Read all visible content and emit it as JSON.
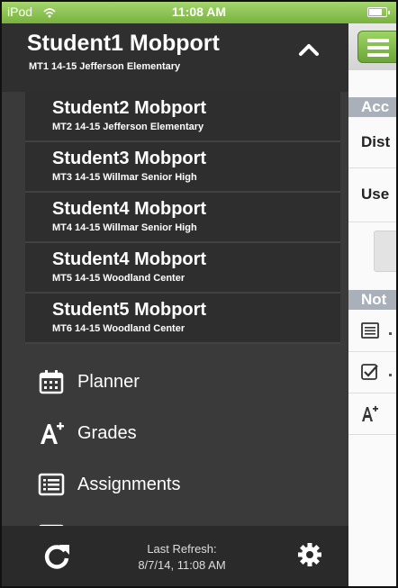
{
  "status_bar": {
    "carrier": "iPod",
    "time": "11:08 AM",
    "battery_level": 0.75
  },
  "current_student": {
    "name": "Student1 Mobport",
    "subtitle": "MT1 14-15 Jefferson Elementary"
  },
  "students": [
    {
      "name": "Student2 Mobport",
      "subtitle": "MT2 14-15 Jefferson Elementary"
    },
    {
      "name": "Student3 Mobport",
      "subtitle": "MT3 14-15 Willmar Senior High"
    },
    {
      "name": "Student4 Mobport",
      "subtitle": "MT4 14-15 Willmar Senior High"
    },
    {
      "name": "Student4 Mobport",
      "subtitle": "MT5 14-15 Woodland Center"
    },
    {
      "name": "Student5 Mobport",
      "subtitle": "MT6 14-15 Woodland Center"
    }
  ],
  "menu": {
    "planner": {
      "label": "Planner",
      "icon": "calendar-icon"
    },
    "grades": {
      "label": "Grades",
      "icon": "grades-a-plus-icon"
    },
    "assignments": {
      "label": "Assignments",
      "icon": "list-icon"
    }
  },
  "footer": {
    "last_refresh_label": "Last Refresh:",
    "last_refresh_time": "8/7/14, 11:08 AM"
  },
  "content": {
    "section_account": "Acc",
    "row_district": "Dist",
    "row_user": "Use",
    "section_notifications": "Not"
  },
  "colors": {
    "accent_green": "#79b23e",
    "drawer_bg": "#3a3a3a",
    "section_header": "#a9b0b9"
  }
}
